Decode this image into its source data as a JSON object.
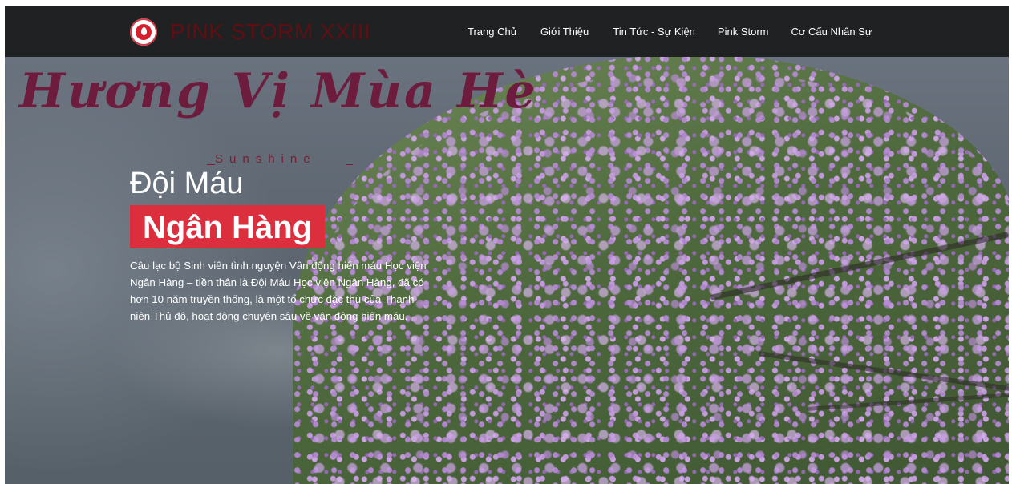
{
  "header": {
    "brand": "PINK STORM XXIII",
    "logo_icon": "blood-drop-logo-icon",
    "nav": [
      {
        "label": "Trang Chủ"
      },
      {
        "label": "Giới Thiệu"
      },
      {
        "label": "Tin Tức - Sự Kiện"
      },
      {
        "label": "Pink Storm"
      },
      {
        "label": "Cơ Cấu Nhân Sự"
      }
    ]
  },
  "hero": {
    "script_title": "Hương Vị Mùa Hè",
    "tagline": "Sunshine",
    "heading": "Đội Máu",
    "highlight": "Ngân Hàng",
    "description": "Câu lạc bộ Sinh viên tình nguyện Vân động hiến máu Học viện Ngân Hàng – tiền thân là Đội Máu Học viện Ngân Hàng, đã có hơn 10 năm truyền thống, là một tổ chức đặc thù của Thanh niên Thủ đô, hoạt động chuyên sâu về vận động hiến máu."
  },
  "colors": {
    "navbar": "#1c1c1e",
    "brand_text": "#5d0f14",
    "highlight_bg": "#dc2f3e",
    "script_title": "#6e1c3d"
  }
}
